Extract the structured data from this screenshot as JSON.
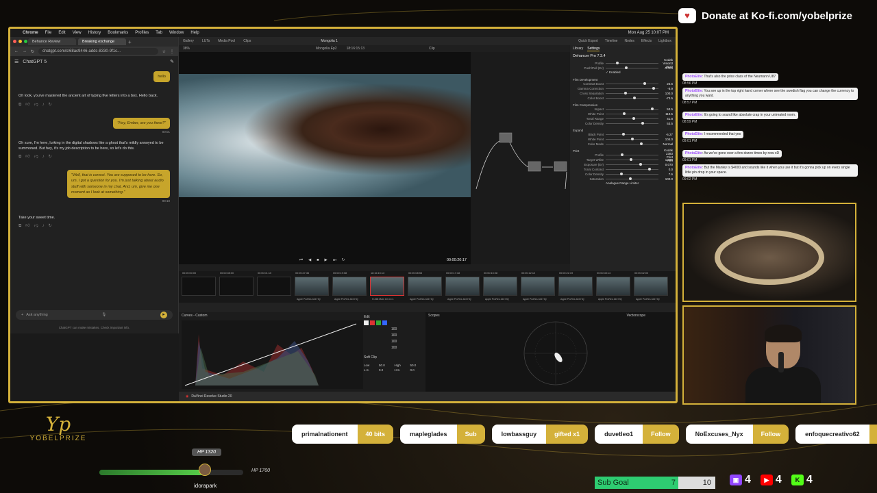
{
  "donate": {
    "text": "Donate at Ko-fi.com/yobelprize",
    "icon": "kofi-cup-icon"
  },
  "macbar": {
    "items": [
      "Chrome",
      "File",
      "Edit",
      "View",
      "History",
      "Bookmarks",
      "Profiles",
      "Tab",
      "Window",
      "Help"
    ],
    "clock": "Mon Aug 25 10:07 PM"
  },
  "chrome": {
    "tabs": [
      "Behance Review",
      "Breaking exchange"
    ],
    "url": "chatgpt.com/c/68ac9446-addc-8330-9f1c...",
    "model": "ChatGPT 5",
    "messages": [
      {
        "role": "user",
        "text": "hello"
      },
      {
        "role": "assistant",
        "text": "Oh look, you've mastered the ancient art of typing five letters into a box. Hello back."
      },
      {
        "role": "user",
        "text": "\"Hey, Ember, are you there?\"",
        "time": "00:01"
      },
      {
        "role": "assistant",
        "text": "Oh sure, I'm here, lurking in the digital shadows like a ghost that's mildly annoyed to be summoned. But hey, it's my job description to be here, so let's do this."
      },
      {
        "role": "user",
        "text": "\"Well, that is correct. You are supposed to be here. So, um, I got a question for you. I'm just talking about audio stuff with someone in my chat. And, um, give me one moment as I look at something.\"",
        "time": "00:10"
      },
      {
        "role": "assistant",
        "text": "Take your sweet time."
      }
    ],
    "placeholder": "Ask anything",
    "disclaimer": "ChatGPT can make mistakes. Check important info."
  },
  "resolve": {
    "menu": [
      "Gallery",
      "LUTs",
      "Media Pool",
      "Clips"
    ],
    "project": "Mongolia 1",
    "timeline": "Mongolia Ep2",
    "timecode_top": "18:16:15:13",
    "right_menu": [
      "Quick Export",
      "Timeline",
      "Nodes",
      "Effects",
      "Lightbox"
    ],
    "zoom": "38%",
    "clip_tab": "Clip",
    "library_tab": "Library",
    "settings_tab": "Settings",
    "plugin": "Dehancer Pro 7.3.4",
    "settings": [
      {
        "label": "Profile",
        "value": "Kodak Vision3 250D"
      },
      {
        "label": "Push/Pull (Ev)",
        "value": "-3.004"
      },
      {
        "section": "Film Development"
      },
      {
        "label": "Contrast Boost",
        "value": "25.6"
      },
      {
        "label": "Gamma Correction",
        "value": "-8.9"
      },
      {
        "label": "Cross Separation",
        "value": "100.0"
      },
      {
        "label": "Color Boost",
        "value": "-73.5"
      },
      {
        "section": "Film Compression"
      },
      {
        "label": "Impact",
        "value": "53.5"
      },
      {
        "label": "White Point",
        "value": "119.5"
      },
      {
        "label": "Tonal Range",
        "value": "41.8"
      },
      {
        "label": "Color Density",
        "value": "53.5"
      },
      {
        "section": "Expand"
      },
      {
        "label": "Black Point",
        "value": "-5.27"
      },
      {
        "label": "White Point",
        "value": "104.0"
      },
      {
        "label": "Color Mode",
        "value": "Normal"
      },
      {
        "section": "Print"
      },
      {
        "label": "Profile",
        "value": "Kodak 2383 Print Film"
      },
      {
        "label": "Target White",
        "value": "1.039"
      },
      {
        "label": "Exposure (Ev)",
        "value": "0.070"
      },
      {
        "label": "Tonal Contrast",
        "value": "0.0"
      },
      {
        "label": "Color Density",
        "value": "7.6"
      },
      {
        "label": "Saturation",
        "value": "100.0"
      }
    ],
    "enabled_label": "Enabled",
    "analogue_label": "Analogue Range Limiter",
    "viewer_tc": "00:00:20:17",
    "clip_timecodes": [
      "00:00:00:00",
      "00:00:08:00",
      "00:00:01:10",
      "00:00:27:36",
      "00:00:19:08",
      "18:16:15:13",
      "00:00:08:53",
      "00:00:17:18",
      "00:00:15:08",
      "00:00:12:12",
      "00:00:22:19",
      "00:00:08:14",
      "00:00:02:00"
    ],
    "clip_codec": "Apple ProRes 422 HQ",
    "selected_clip_label": "H.265 Main 10 4:4:1",
    "curves_title": "Curves - Custom",
    "edit_label": "Edit",
    "curve_values": [
      "100",
      "100",
      "100",
      "100"
    ],
    "softclip_label": "Soft Clip",
    "softclip_fields": [
      {
        "label": "Low",
        "value": "50.0"
      },
      {
        "label": "High",
        "value": "50.0"
      },
      {
        "label": "L.S.",
        "value": "0.0"
      },
      {
        "label": "H.S.",
        "value": "0.0"
      }
    ],
    "scopes_title": "Scopes",
    "scope_type": "Vectorscope",
    "app_name": "DaVinci Resolve Studio 20"
  },
  "chat_feed": [
    {
      "user": "PhotoElite",
      "text": ": That's also the price class of the Neumann U87",
      "time": "08:56 PM"
    },
    {
      "user": "PhotoElite",
      "text": ": You see up in the top right hand corner where see the swedish flag you can change the currency to anything you want.",
      "time": "08:57 PM"
    },
    {
      "user": "PhotoElite",
      "text": ": It's going to sound like absolute crap in your untreated room.",
      "time": "08:59 PM"
    },
    {
      "user": "PhotoElite",
      "text": ": I recommended that yes",
      "time": "09:01 PM"
    },
    {
      "user": "PhotoElite",
      "text": ": As we've gone over a few dozen times by now xD",
      "time": "09:01 PM"
    },
    {
      "user": "PhotoElite",
      "text": ": But the Manley is $4000 and sounds like it when you use it but it's gonna pick up on every single little pin drop in your space.",
      "time": "09:02 PM"
    }
  ],
  "brand": {
    "name": "YOBELPRIZE"
  },
  "events": [
    {
      "name": "primalnationent",
      "kind": "40 bits"
    },
    {
      "name": "mapleglades",
      "kind": "Sub"
    },
    {
      "name": "lowbassguy",
      "kind": "gifted x1"
    },
    {
      "name": "duvetleo1",
      "kind": "Follow"
    },
    {
      "name": "NoExcuses_Nyx",
      "kind": "Follow"
    },
    {
      "name": "enfoquecreativo62",
      "kind": "Follow"
    }
  ],
  "hp": {
    "top": "HP 1320",
    "side": "HP 1700",
    "user": "idorapark",
    "fill": 0.75
  },
  "subgoal": {
    "label": "Sub Goal",
    "current": "7",
    "target": "10"
  },
  "socials": [
    {
      "icon": "twitch-icon",
      "count": "4",
      "color": "#9146ff"
    },
    {
      "icon": "youtube-icon",
      "count": "4",
      "color": "#ff0000"
    },
    {
      "icon": "kick-icon",
      "count": "4",
      "color": "#53fc18"
    }
  ],
  "colors": {
    "accent": "#d4b13a",
    "bubble": "#c7a52b"
  }
}
